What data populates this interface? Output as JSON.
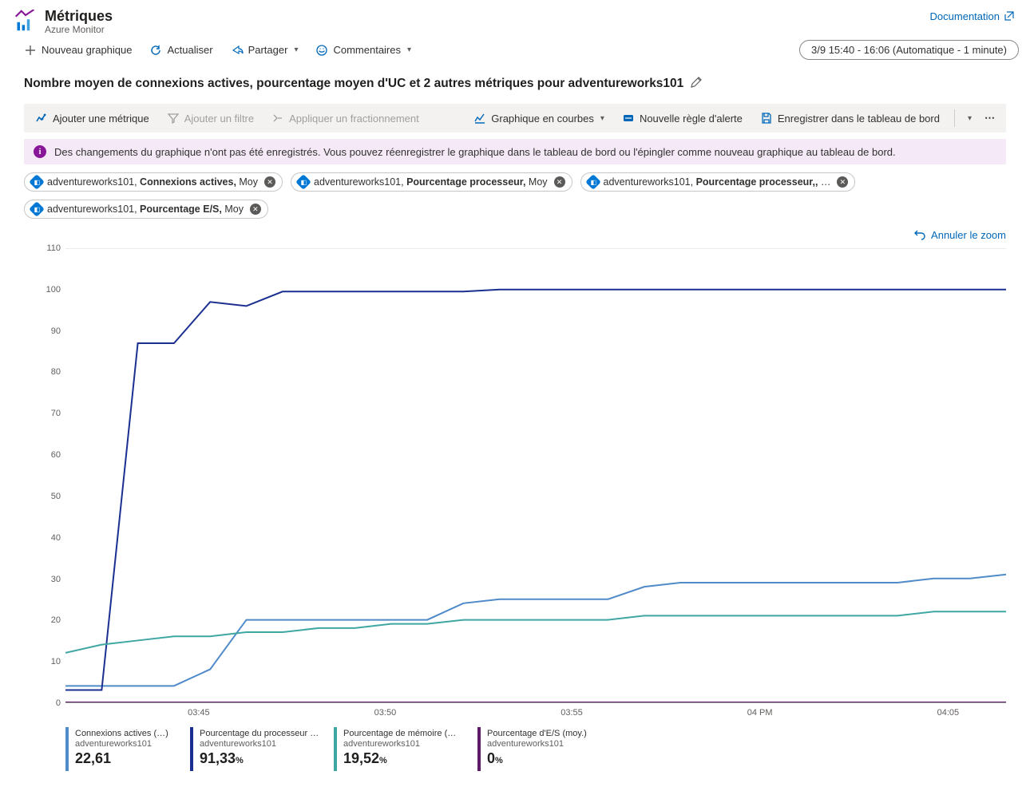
{
  "header": {
    "title": "Métriques",
    "subtitle": "Azure Monitor",
    "doc_link": "Documentation"
  },
  "cmd": {
    "new": "Nouveau graphique",
    "refresh": "Actualiser",
    "share": "Partager",
    "feedback": "Commentaires",
    "time": "3/9 15:40 - 16:06 (Automatique - 1 minute)"
  },
  "chart_title": "Nombre moyen de connexions actives, pourcentage moyen d'UC et 2 autres métriques pour adventureworks101",
  "toolbar": {
    "add_metric": "Ajouter une métrique",
    "add_filter": "Ajouter un filtre",
    "apply_split": "Appliquer un fractionnement",
    "chart_type": "Graphique en courbes",
    "alert": "Nouvelle règle d'alerte",
    "save": "Enregistrer dans le tableau de bord"
  },
  "notif": "Des changements du graphique n'ont pas été enregistrés. Vous pouvez réenregistrer le graphique dans le tableau de bord ou l'épingler comme nouveau graphique au tableau de bord.",
  "pills": [
    {
      "resource": "adventureworks101",
      "metric": "Connexions actives",
      "agg": "Moy"
    },
    {
      "resource": "adventureworks101",
      "metric": "Pourcentage processeur",
      "agg": "Moy"
    },
    {
      "resource": "adventureworks101",
      "metric": "Pourcentage processeur,",
      "agg": "…"
    },
    {
      "resource": "adventureworks101",
      "metric": "Pourcentage E/S",
      "agg": "Moy"
    }
  ],
  "zoom_label": "Annuler le zoom",
  "chart_data": {
    "type": "line",
    "ylim": [
      0,
      110
    ],
    "yticks": [
      0,
      10,
      20,
      30,
      40,
      50,
      60,
      70,
      80,
      90,
      100,
      110
    ],
    "xlabels": [
      "03:45",
      "03:50",
      "03:55",
      "04 PM",
      "04:05"
    ],
    "x_count": 27,
    "series": [
      {
        "name": "Connexions actives (…)",
        "resource": "adventureworks101",
        "value": "22,61",
        "unit": "",
        "color": "#4f8ac9",
        "values": [
          4,
          4,
          4,
          4,
          8,
          20,
          20,
          20,
          20,
          20,
          20,
          24,
          25,
          25,
          25,
          25,
          28,
          29,
          29,
          29,
          29,
          29,
          29,
          29,
          30,
          30,
          31
        ]
      },
      {
        "name": "Pourcentage du processeur (Moy.)",
        "resource": "adventureworks101",
        "value": "91,33",
        "unit": "%",
        "color": "#1b2f91",
        "values": [
          3,
          3,
          87,
          87,
          97,
          96,
          99.5,
          99.5,
          99.5,
          99.5,
          99.5,
          99.5,
          100,
          100,
          100,
          100,
          100,
          100,
          100,
          100,
          100,
          100,
          100,
          100,
          100,
          100,
          100
        ]
      },
      {
        "name": "Pourcentage de mémoire (Moy.)",
        "resource": "adventureworks101",
        "value": "19,52",
        "unit": "%",
        "color": "#3fa7a2",
        "values": [
          12,
          14,
          15,
          16,
          16,
          17,
          17,
          18,
          18,
          19,
          19,
          20,
          20,
          20,
          20,
          20,
          21,
          21,
          21,
          21,
          21,
          21,
          21,
          21,
          22,
          22,
          22
        ]
      },
      {
        "name": "Pourcentage d'E/S (moy.)",
        "resource": "adventureworks101",
        "value": "0",
        "unit": "%",
        "color": "#5e1a6b",
        "values": [
          0,
          0,
          0,
          0,
          0,
          0,
          0,
          0,
          0,
          0,
          0,
          0,
          0,
          0,
          0,
          0,
          0,
          0,
          0,
          0,
          0,
          0,
          0,
          0,
          0,
          0,
          0
        ]
      }
    ]
  }
}
